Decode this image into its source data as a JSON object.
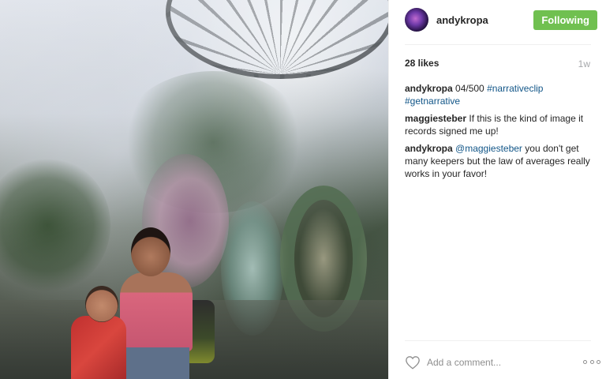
{
  "post": {
    "username": "andykropa",
    "follow_label": "Following",
    "likes": "28 likes",
    "time": "1w",
    "caption": {
      "author": "andykropa",
      "text": "04/500",
      "tags": [
        "#narrativeclip",
        "#getnarrative"
      ]
    },
    "comments": [
      {
        "author": "maggiesteber",
        "text": "If this is the kind of image it records signed me up!"
      },
      {
        "author": "andykropa",
        "mention": "@maggiesteber",
        "text": "you don't get many keepers but the law of averages really works in your favor!"
      }
    ],
    "comment_placeholder": "Add a comment...",
    "icons": {
      "like": "heart-icon",
      "more": "more-options-icon"
    }
  },
  "colors": {
    "follow_button": "#70c050",
    "link": "#125688",
    "muted": "#a5a7aa"
  }
}
